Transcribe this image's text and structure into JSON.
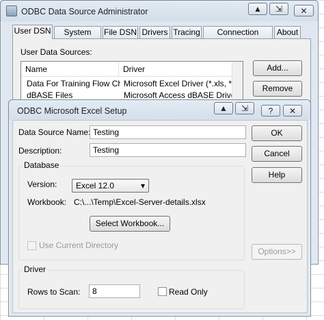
{
  "outer_window": {
    "title": "ODBC Data Source Administrator",
    "pin_btn": "▲",
    "restore_btn": "⇲",
    "close_btn": "✕",
    "tabs": [
      "User DSN",
      "System DSN",
      "File DSN",
      "Drivers",
      "Tracing",
      "Connection Pooling",
      "About"
    ],
    "active_tab": "User DSN",
    "user_data_sources_label": "User Data Sources:",
    "columns": [
      "Name",
      "Driver"
    ],
    "rows": [
      {
        "name": "Data For Training Flow Chart",
        "driver": "Microsoft Excel Driver (*.xls, *.xlsx"
      },
      {
        "name": "dBASE Files",
        "driver": "Microsoft Access dBASE Driver (*"
      }
    ],
    "add_btn": "Add...",
    "remove_btn": "Remove"
  },
  "inner_window": {
    "title": "ODBC Microsoft Excel Setup",
    "pin_btn": "▲",
    "restore_btn": "⇲",
    "help_btn": "?",
    "close_btn": "✕",
    "data_source_name_label": "Data Source Name:",
    "data_source_name_value": "Testing",
    "description_label": "Description:",
    "description_value": "Testing",
    "database_group": "Database",
    "version_label": "Version:",
    "version_value": "Excel 12.0",
    "workbook_label": "Workbook:",
    "workbook_value": "C:\\...\\Temp\\Excel-Server-details.xlsx",
    "select_workbook_btn": "Select Workbook...",
    "use_current_dir_label": "Use Current Directory",
    "driver_group": "Driver",
    "rows_to_scan_label": "Rows to Scan:",
    "rows_to_scan_value": "8",
    "read_only_label": "Read Only",
    "ok_btn": "OK",
    "cancel_btn": "Cancel",
    "help_text_btn": "Help",
    "options_btn": "Options>>"
  }
}
